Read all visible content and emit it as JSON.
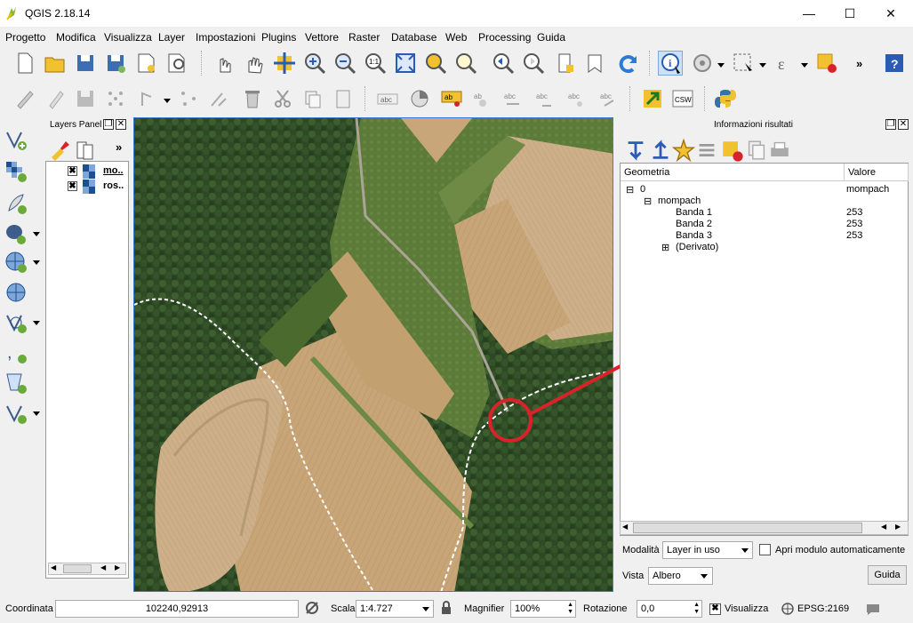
{
  "window": {
    "title": "QGIS 2.18.14",
    "minimize": "—",
    "maximize": "☐",
    "close": "✕"
  },
  "menu": [
    "Progetto",
    "Modifica",
    "Visualizza",
    "Layer",
    "Impostazioni",
    "Plugins",
    "Vettore",
    "Raster",
    "Database",
    "Web",
    "Processing",
    "Guida"
  ],
  "toolbar_more": "»",
  "layers_panel": {
    "title": "Layers Panel",
    "more": "»",
    "layers": [
      {
        "name": "mo..",
        "checked": "✖"
      },
      {
        "name": "ros..",
        "checked": "✖"
      }
    ]
  },
  "info_panel": {
    "title": "Informazioni risultati",
    "columns": {
      "geometry": "Geometria",
      "value": "Valore"
    },
    "rows": [
      {
        "label": "0",
        "value": "mompach",
        "expander": "⊟"
      },
      {
        "label": "mompach",
        "value": "",
        "expander": "⊟"
      },
      {
        "label": "Banda 1",
        "value": "253"
      },
      {
        "label": "Banda 2",
        "value": "253"
      },
      {
        "label": "Banda 3",
        "value": "253"
      },
      {
        "label": "(Derivato)",
        "value": "",
        "expander": "⊞"
      }
    ],
    "mode_label": "Modalità",
    "mode_value": "Layer in uso",
    "auto_open_label": "Apri modulo automaticamente",
    "view_label": "Vista",
    "view_value": "Albero",
    "help_button": "Guida"
  },
  "statusbar": {
    "coord_label": "Coordinata",
    "coord_value": "102240,92913",
    "scale_label": "Scala",
    "scale_value": "1:4.727",
    "magnifier_label": "Magnifier",
    "magnifier_value": "100%",
    "rotation_label": "Rotazione",
    "rotation_value": "0,0",
    "render_label": "Visualizza",
    "render_checked": "✖",
    "crs": "EPSG:2169"
  },
  "annotation_color": "#d9232a"
}
